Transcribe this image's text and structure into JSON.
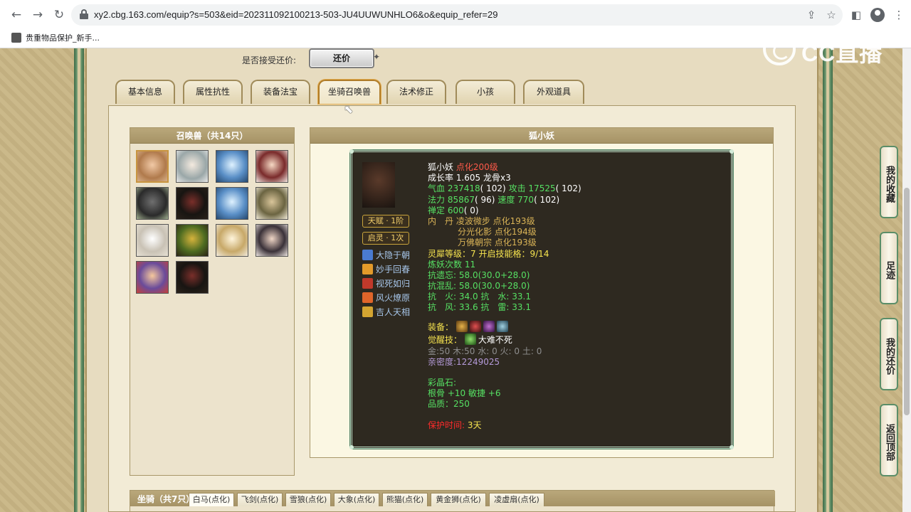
{
  "browser": {
    "url": "xy2.cbg.163.com/equip?s=503&eid=202311092100213-503-JU4UUWUNHLO6&o&equip_refer=29",
    "bookmark": "贵重物品保护_新手..."
  },
  "watermark": {
    "text": "CC直播"
  },
  "offer": {
    "label": "是否接受还价:",
    "button": "还价"
  },
  "tabs": [
    "基本信息",
    "属性抗性",
    "装备法宝",
    "坐骑召唤兽",
    "法术修正",
    "小孩",
    "外观道具"
  ],
  "summons": {
    "title": "召唤兽（共14只）"
  },
  "detail": {
    "title": "狐小妖",
    "name": "狐小妖",
    "level": "点化200级",
    "growth": "成长率 1.605 龙骨x3",
    "hp_label": "气血",
    "hp": "237418",
    "hp_base": "( 102)",
    "atk_label": "攻击",
    "atk": "17525",
    "atk_base": "( 102)",
    "mp_label": "法力",
    "mp": "85867",
    "mp_base": "( 96)",
    "spd_label": "速度",
    "spd": "770",
    "spd_base": "( 102)",
    "zen_label": "禅定",
    "zen": "600",
    "zen_base": "( 0)",
    "neidan_label": "内　丹",
    "neidan": [
      "凌波微步 点化193级",
      "分光化影 点化194级",
      "万佛朝宗 点化193级"
    ],
    "lingxi_label": "灵犀等级：",
    "lingxi": "7",
    "lingxi_slots_label": "开启技能格：",
    "lingxi_slots": "9/14",
    "refine": "炼妖次数 11",
    "resists": [
      "抗遗忘: 58.0(30.0+28.0)",
      "抗混乱: 58.0(30.0+28.0)",
      "抗　火: 34.0 抗　水: 33.1",
      "抗　风: 33.6 抗　雷: 33.1"
    ],
    "equip_label": "装备：",
    "awaken_label": "觉醒技：",
    "awaken": "大难不死",
    "elements": "金:50 木:50 水: 0 火: 0 土: 0",
    "intimacy": "亲密度:12249025",
    "crystal_label": "彩晶石:",
    "crystal_attr": "根骨 +10 敏捷 +6",
    "crystal_quality": "品质：250",
    "protect_label": "保护时间:",
    "protect": "3天",
    "badges": [
      "天赋 · 1阶",
      "启灵 · 1次"
    ],
    "skills": [
      "大隐于朝",
      "妙手回春",
      "视死如归",
      "风火燎原",
      "吉人天相"
    ]
  },
  "side_buttons": [
    "我的收藏",
    "足迹",
    "我的还价",
    "返回顶部"
  ],
  "mounts": {
    "title": "坐骑（共7只）",
    "tabs": [
      "白马(点化)",
      "飞剑(点化)",
      "雪狼(点化)",
      "大象(点化)",
      "熊猫(点化)",
      "黄金狮(点化)",
      "凌虚扇(点化)"
    ]
  },
  "colors": {
    "accent": "#b07d2a",
    "tooltip_bg": "#2e2920",
    "page_bg": "#c8b584"
  }
}
